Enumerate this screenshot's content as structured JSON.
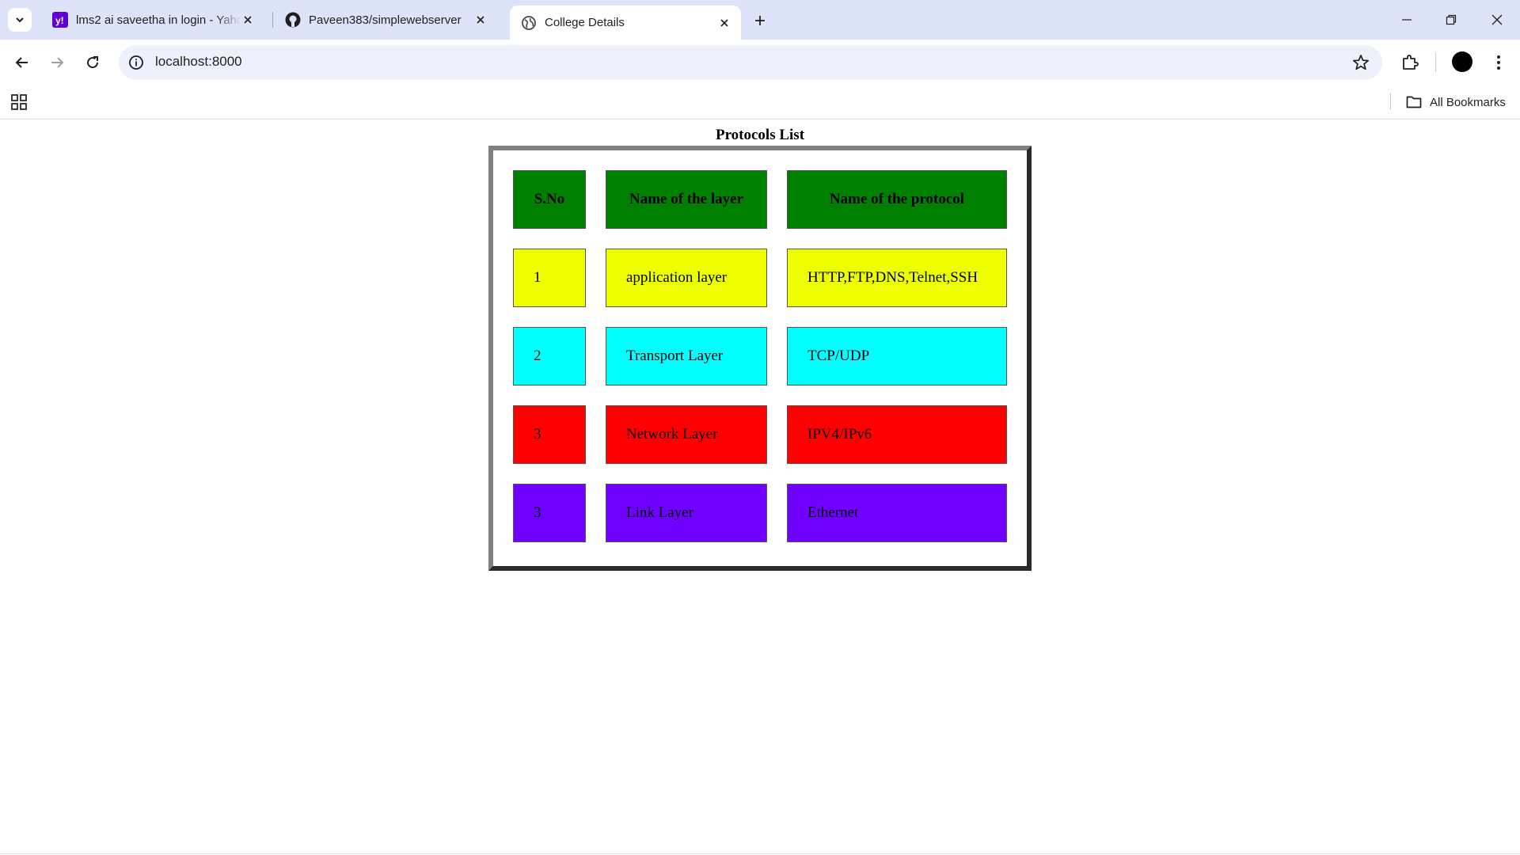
{
  "browser": {
    "tabs": [
      {
        "title": "lms2 ai saveetha in login - Yahoo",
        "icon": "yahoo-icon",
        "active": false
      },
      {
        "title": "Paveen383/simplewebserver",
        "icon": "github-icon",
        "active": false
      },
      {
        "title": "College Details",
        "icon": "globe-icon",
        "active": true
      }
    ],
    "url": "localhost:8000",
    "bookmarks_label": "All Bookmarks"
  },
  "page": {
    "title": "Protocols List",
    "table": {
      "headers": [
        "S.No",
        "Name of the layer",
        "Name of the protocol"
      ],
      "header_color": "#008000",
      "rows": [
        {
          "cells": [
            "1",
            "application layer",
            "HTTP,FTP,DNS,Telnet,SSH"
          ],
          "color": "#eeff00"
        },
        {
          "cells": [
            "2",
            "Transport Layer",
            "TCP/UDP"
          ],
          "color": "#00ffff"
        },
        {
          "cells": [
            "3",
            "Network Layer",
            "IPV4/IPv6"
          ],
          "color": "#ff0000"
        },
        {
          "cells": [
            "3",
            "Link Layer",
            "Ethernet"
          ],
          "color": "#7000ff"
        }
      ]
    }
  }
}
